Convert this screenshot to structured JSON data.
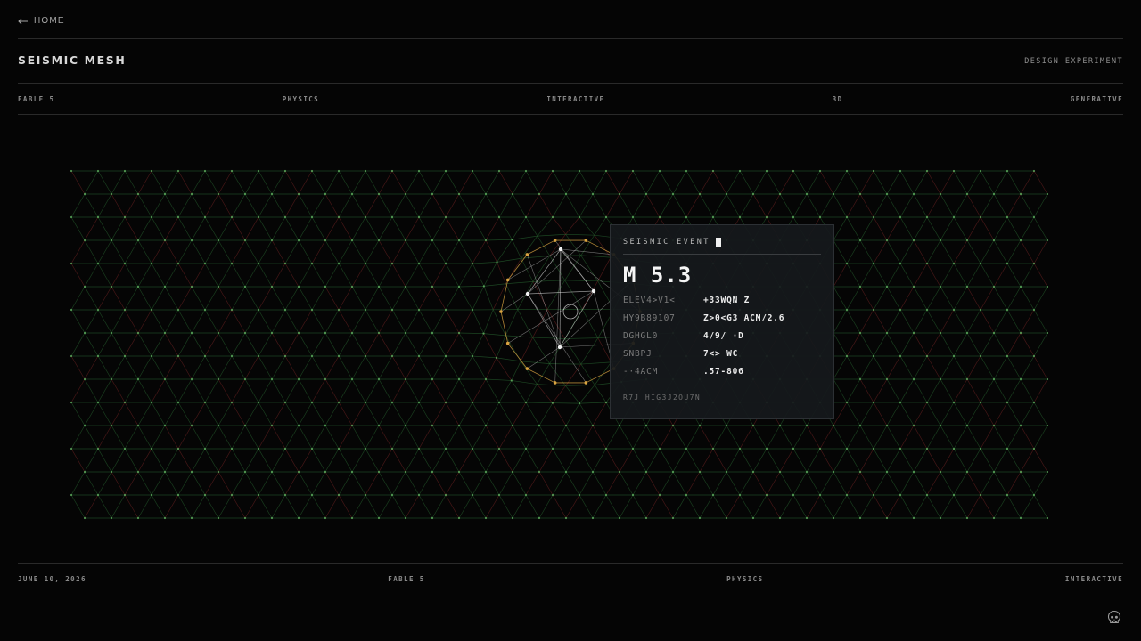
{
  "nav": {
    "back_label": "HOME",
    "back_icon": "arrow-left-icon"
  },
  "header": {
    "title": "SEISMIC MESH",
    "subtitle": "DESIGN EXPERIMENT"
  },
  "tags": [
    "FABLE 5",
    "PHYSICS",
    "INTERACTIVE",
    "3D",
    "GENERATIVE"
  ],
  "event_panel": {
    "heading": "SEISMIC EVENT",
    "magnitude": "M 5.3",
    "rows": [
      {
        "key": "ELEV4>V1<",
        "value": "+33WQN Z"
      },
      {
        "key": "HY9B89107",
        "value": "Z>0<G3 ACM/2.6"
      },
      {
        "key": "DGHGL0",
        "value": "4/9/ ·D"
      },
      {
        "key": "SNBPJ",
        "value": "7<> WC"
      },
      {
        "key": "-·4ACM",
        "value": ".57-806"
      }
    ],
    "footer": "R7J HIG3J2OU7N"
  },
  "footer": {
    "meta": [
      "JUNE 10, 2026",
      "FABLE 5",
      "PHYSICS",
      "INTERACTIVE"
    ],
    "icon": "skull-icon"
  },
  "colors": {
    "background": "#050505",
    "mesh_green": "#2f7a3a",
    "mesh_red": "#8a2a2a",
    "node_amber": "#d9a441",
    "node_white": "#f2f2f2"
  }
}
